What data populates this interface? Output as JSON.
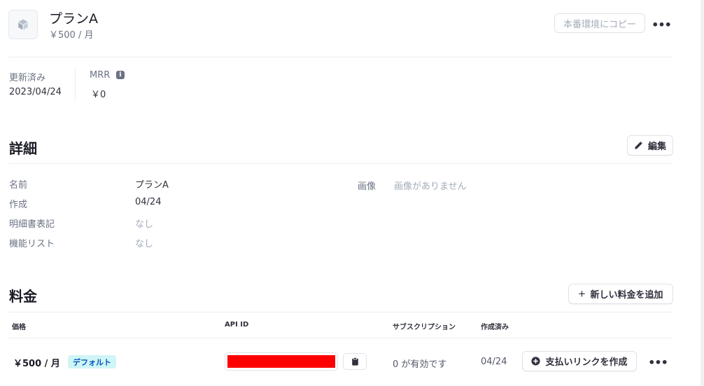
{
  "header": {
    "icon": "cube-icon",
    "title": "プランA",
    "subtitle": "￥500 / 月",
    "copy_button": "本番環境にコピー",
    "more_label": "•••"
  },
  "stats": {
    "updated_label": "更新済み",
    "updated_value": "2023/04/24",
    "mrr_label": "MRR",
    "mrr_info": "i",
    "mrr_value": "￥0"
  },
  "details": {
    "title": "詳細",
    "edit_button": "編集",
    "name_label": "名前",
    "name_value": "プランA",
    "created_label": "作成",
    "created_value": "04/24",
    "statement_label": "明細書表記",
    "statement_value": "なし",
    "features_label": "機能リスト",
    "features_value": "なし",
    "image_label": "画像",
    "image_value": "画像がありません"
  },
  "pricing": {
    "title": "料金",
    "add_button": "新しい料金を追加",
    "columns": [
      "価格",
      "API ID",
      "サブスクリプション",
      "作成済み"
    ],
    "rows": [
      {
        "price": "￥500 / 月",
        "badge": "デフォルト",
        "subscriptions": "0 が有効です",
        "created": "04/24",
        "payment_link_button": "支払いリンクを作成",
        "more_label": "•••"
      }
    ]
  },
  "colors": {
    "badge_bg": "#cff5f6",
    "badge_text": "#0055bc",
    "redaction": "#ff0000"
  }
}
